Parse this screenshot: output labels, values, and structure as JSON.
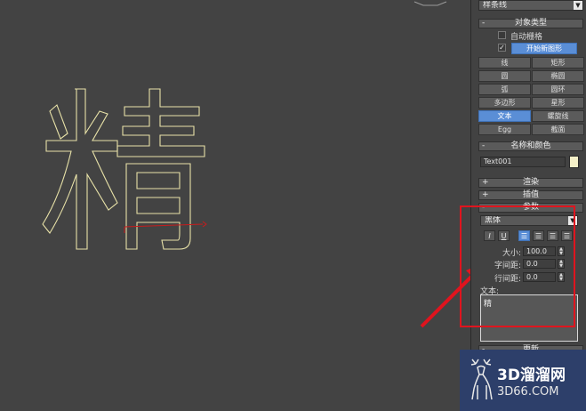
{
  "viewport": {
    "text_shape_glyph": "精"
  },
  "command_panel": {
    "category_dropdown": "样条线",
    "object_type": {
      "title": "对象类型",
      "auto_grid_label": "自动栅格",
      "start_new_shape_label": "开始新图形",
      "start_new_shape_checked": true,
      "buttons": [
        {
          "label": "线",
          "active": false
        },
        {
          "label": "矩形",
          "active": false
        },
        {
          "label": "圆",
          "active": false
        },
        {
          "label": "椭圆",
          "active": false
        },
        {
          "label": "弧",
          "active": false
        },
        {
          "label": "圆环",
          "active": false
        },
        {
          "label": "多边形",
          "active": false
        },
        {
          "label": "星形",
          "active": false
        },
        {
          "label": "文本",
          "active": true
        },
        {
          "label": "螺旋线",
          "active": false
        },
        {
          "label": "Egg",
          "active": false
        },
        {
          "label": "截面",
          "active": false
        }
      ]
    },
    "name_color": {
      "title": "名称和颜色",
      "name_value": "Text001",
      "swatch_color": "#f5f0c8"
    },
    "rendering_title": "渲染",
    "interpolation_title": "插值",
    "parameters": {
      "title": "参数",
      "font_dropdown": "黑体",
      "italic_label": "I",
      "underline_label": "U",
      "size_label": "大小:",
      "size_value": "100.0",
      "kerning_label": "字间距:",
      "kerning_value": "0.0",
      "leading_label": "行间距:",
      "leading_value": "0.0",
      "text_label": "文本:",
      "text_value": "精"
    },
    "bottom_rollout_title": "更新"
  },
  "watermark": {
    "title": "3D溜溜网",
    "url": "3D66.COM"
  },
  "colors": {
    "highlight_box": "#e0141e",
    "arrow": "#e0141e",
    "active_button": "#5a8ed6",
    "spline_outline": "#e8e2a8"
  }
}
